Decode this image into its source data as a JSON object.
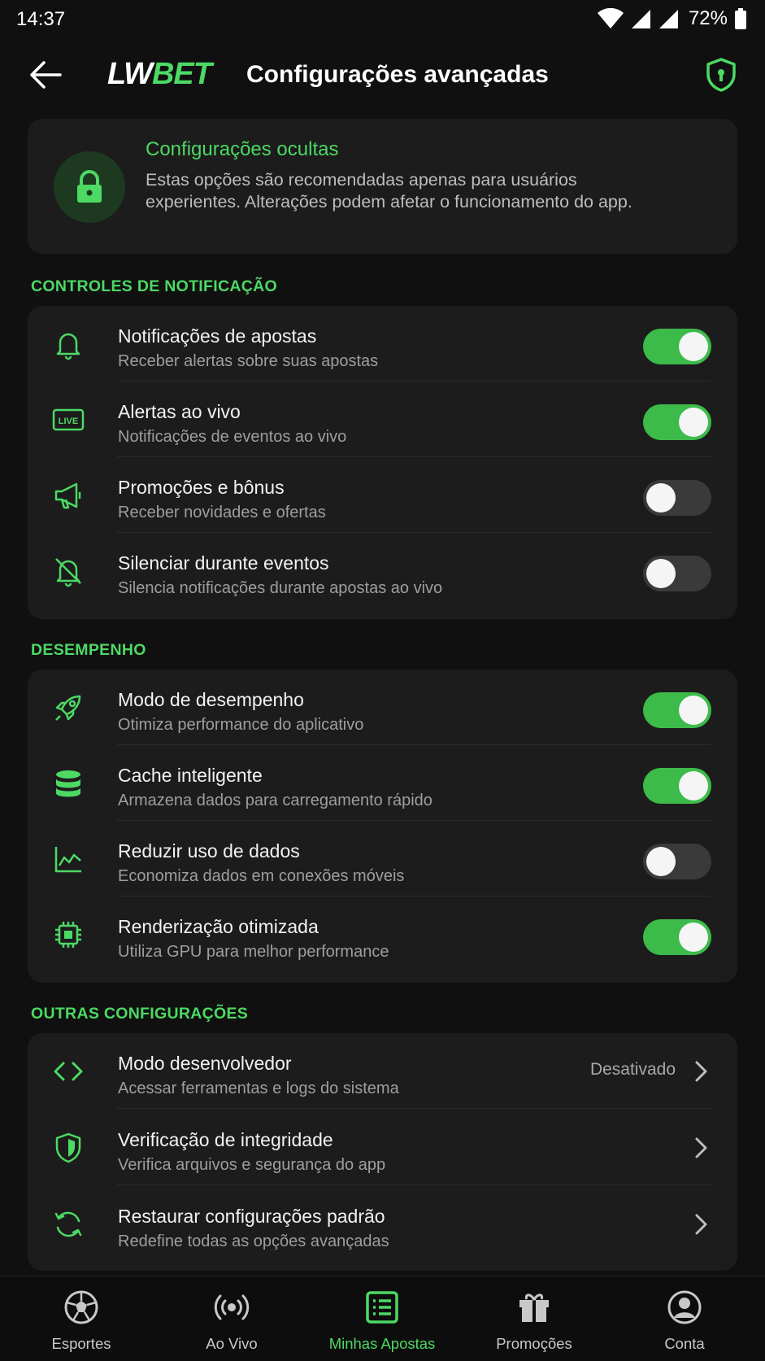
{
  "status_bar": {
    "time": "14:37",
    "battery": "72%"
  },
  "app_bar": {
    "logo_lw": "LW",
    "logo_bet": "BET",
    "title": "Configurações avançadas"
  },
  "info_card": {
    "title": "Configurações ocultas",
    "description": "Estas opções são recomendadas apenas para usuários experientes. Alterações podem afetar o funcionamento do app."
  },
  "sections": {
    "notifications": {
      "title": "CONTROLES DE NOTIFICAÇÃO",
      "items": [
        {
          "label": "Notificações de apostas",
          "sub": "Receber alertas sobre suas apostas",
          "on": true,
          "icon": "bell-icon"
        },
        {
          "label": "Alertas ao vivo",
          "sub": "Notificações de eventos ao vivo",
          "on": true,
          "icon": "live-icon"
        },
        {
          "label": "Promoções e bônus",
          "sub": "Receber novidades e ofertas",
          "on": false,
          "icon": "megaphone-icon"
        },
        {
          "label": "Silenciar durante eventos",
          "sub": "Silencia notificações durante apostas ao vivo",
          "on": false,
          "icon": "bell-off-icon"
        }
      ]
    },
    "performance": {
      "title": "DESEMPENHO",
      "items": [
        {
          "label": "Modo de desempenho",
          "sub": "Otimiza performance do aplicativo",
          "on": true,
          "icon": "rocket-icon"
        },
        {
          "label": "Cache inteligente",
          "sub": "Armazena dados para carregamento rápido",
          "on": true,
          "icon": "database-icon"
        },
        {
          "label": "Reduzir uso de dados",
          "sub": "Economiza dados em conexões móveis",
          "on": false,
          "icon": "chart-line-icon"
        },
        {
          "label": "Renderização otimizada",
          "sub": "Utiliza GPU para melhor performance",
          "on": true,
          "icon": "chip-icon"
        }
      ]
    },
    "other": {
      "title": "OUTRAS CONFIGURAÇÕES",
      "items": [
        {
          "label": "Modo desenvolvedor",
          "sub": "Acessar ferramentas e logs do sistema",
          "value": "Desativado",
          "icon": "code-icon"
        },
        {
          "label": "Verificação de integridade",
          "sub": "Verifica arquivos e segurança do app",
          "icon": "shield-check-icon"
        },
        {
          "label": "Restaurar configurações padrão",
          "sub": "Redefine todas as opções avançadas",
          "icon": "refresh-icon"
        }
      ]
    }
  },
  "bottom_nav": [
    {
      "label": "Esportes",
      "icon": "soccer-ball-icon",
      "active": false
    },
    {
      "label": "Ao Vivo",
      "icon": "broadcast-icon",
      "active": false
    },
    {
      "label": "Minhas Apostas",
      "icon": "bet-slip-icon",
      "active": true
    },
    {
      "label": "Promoções",
      "icon": "gift-icon",
      "active": false
    },
    {
      "label": "Conta",
      "icon": "account-icon",
      "active": false
    }
  ],
  "colors": {
    "accent": "#4cd964",
    "toggle_on": "#3dbb4a",
    "background": "#101010",
    "card": "#1c1c1c"
  }
}
